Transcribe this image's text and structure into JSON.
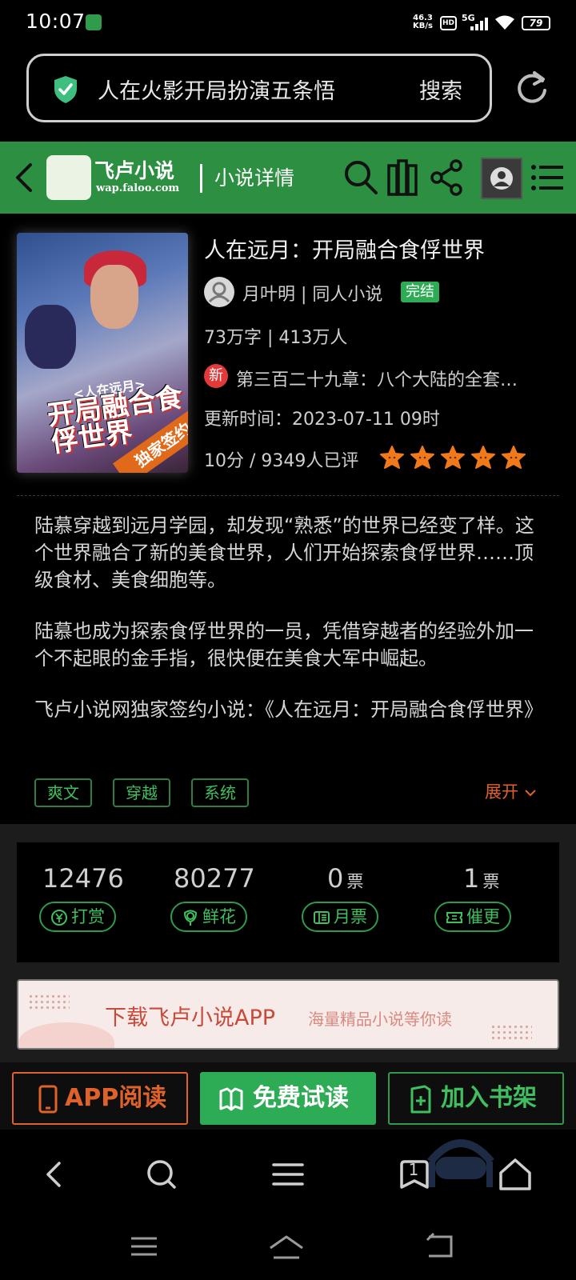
{
  "status_bar": {
    "time": "10:07",
    "net_speed": "46.3",
    "net_speed_unit": "KB/s",
    "hd": "HD",
    "network": "5G",
    "battery": "79"
  },
  "url_bar": {
    "query": "人在火影开局扮演五条悟",
    "search_label": "搜索"
  },
  "header": {
    "logo_title": "飞卢小说",
    "logo_url": "wap.faloo.com",
    "page_title": "小说详情"
  },
  "book": {
    "cover_subtitle": "<人在远月>",
    "cover_title": "开局融合食俘世界",
    "cover_ribbon": "独家签约",
    "title": "人在远月：开局融合食俘世界",
    "author_line": "月叶明 | 同人小说",
    "status": "完结",
    "stats": "73万字 | 413万人",
    "new_badge": "新",
    "latest_chapter": "第三百二十九章：八个大陆的全套…",
    "update_time": "更新时间：2023-07-11 09时",
    "rating_text": "10分 / 9349人已评",
    "stars": 5
  },
  "synopsis": {
    "p1": "陆慕穿越到远月学园，却发现“熟悉”的世界已经变了样。这个世界融合了新的美食世界，人们开始探索食俘世界……顶级食材、美食细胞等。",
    "p2": "陆慕也成为探索食俘世界的一员，凭借穿越者的经验外加一个不起眼的金手指，很快便在美食大军中崛起。",
    "p3": "飞卢小说网独家签约小说：《人在远月：开局融合食俘世界》"
  },
  "tags": [
    "爽文",
    "穿越",
    "系统"
  ],
  "expand_label": "展开",
  "support": [
    {
      "value": "12476",
      "unit": "",
      "label": "打赏"
    },
    {
      "value": "80277",
      "unit": "",
      "label": "鲜花"
    },
    {
      "value": "0",
      "unit": "票",
      "label": "月票"
    },
    {
      "value": "1",
      "unit": "票",
      "label": "催更"
    }
  ],
  "banner": {
    "title": "下载飞卢小说APP",
    "subtitle": "海量精品小说等你读"
  },
  "actions": {
    "app_read": "APP阅读",
    "free_read": "免费试读",
    "add_shelf": "加入书架"
  },
  "browser_nav": {
    "tab_count": "1"
  },
  "colors": {
    "brand_green": "#2c8f41",
    "accent_green": "#2eab55",
    "accent_orange": "#e0622b",
    "new_red": "#e23a3a"
  }
}
